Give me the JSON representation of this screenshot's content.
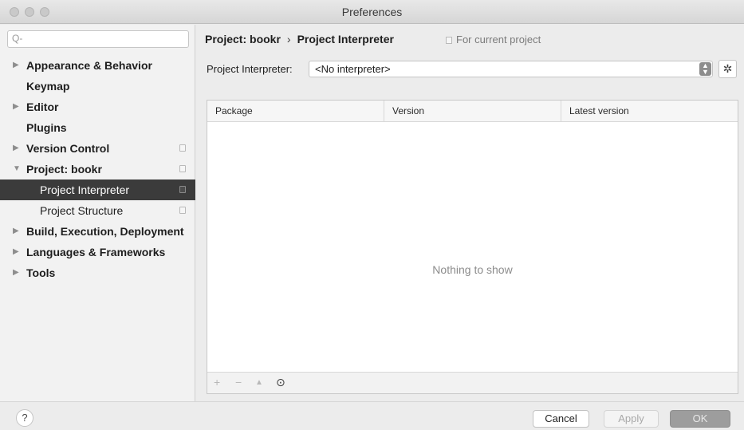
{
  "window": {
    "title": "Preferences"
  },
  "sidebar": {
    "search_placeholder": "Q-",
    "items": [
      {
        "label": "Appearance & Behavior",
        "expandable": true
      },
      {
        "label": "Keymap",
        "expandable": false
      },
      {
        "label": "Editor",
        "expandable": true
      },
      {
        "label": "Plugins",
        "expandable": false
      },
      {
        "label": "Version Control",
        "expandable": true
      },
      {
        "label": "Project: bookr",
        "expandable": true,
        "expanded": true
      },
      {
        "label": "Project Interpreter",
        "selected": true
      },
      {
        "label": "Project Structure"
      },
      {
        "label": "Build, Execution, Deployment",
        "expandable": true
      },
      {
        "label": "Languages & Frameworks",
        "expandable": true
      },
      {
        "label": "Tools",
        "expandable": true
      }
    ]
  },
  "main": {
    "breadcrumb": {
      "parent": "Project: bookr",
      "separator": "›",
      "current": "Project Interpreter"
    },
    "scope_label": "For current project",
    "interpreter_label": "Project Interpreter:",
    "interpreter_value": "<No interpreter>",
    "table": {
      "columns": [
        "Package",
        "Version",
        "Latest version"
      ],
      "empty_text": "Nothing to show"
    },
    "toolbar": {
      "add": "+",
      "remove": "−",
      "upgrade": "▲",
      "show": "⊙"
    }
  },
  "footer": {
    "help_label": "?",
    "cancel_label": "Cancel",
    "apply_label": "Apply",
    "ok_label": "OK"
  }
}
